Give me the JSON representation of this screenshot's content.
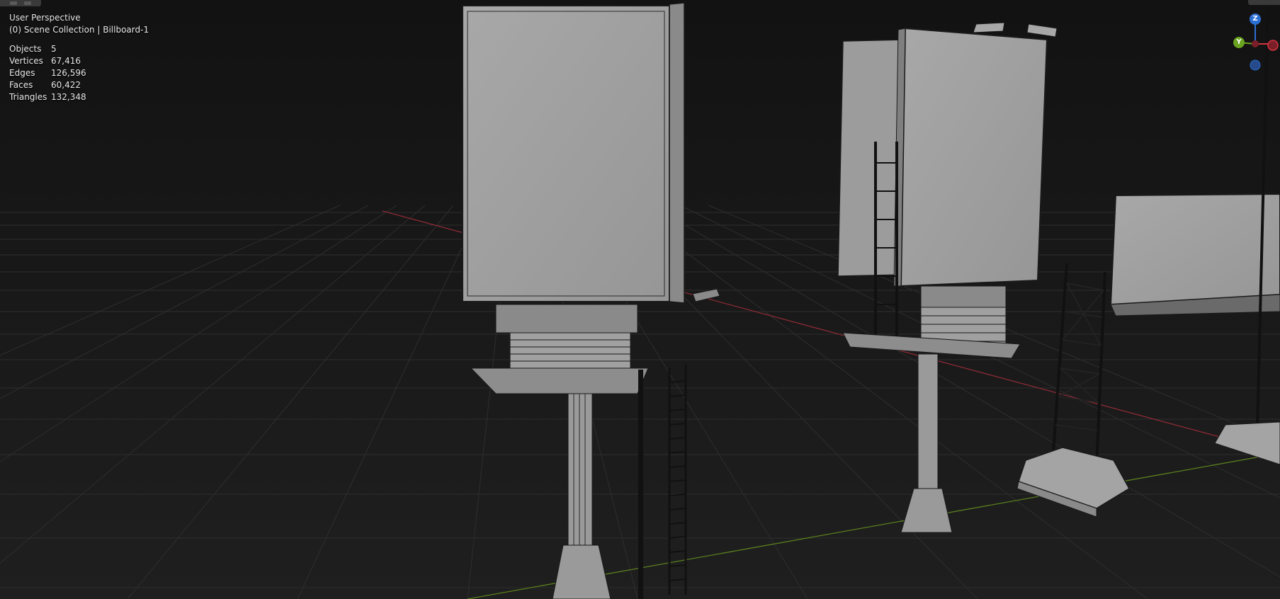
{
  "viewport": {
    "view_name": "User Perspective",
    "collection_line": "(0) Scene Collection | Billboard-1",
    "stats": [
      {
        "label": "Objects",
        "value": "5"
      },
      {
        "label": "Vertices",
        "value": "67,416"
      },
      {
        "label": "Edges",
        "value": "126,596"
      },
      {
        "label": "Faces",
        "value": "60,422"
      },
      {
        "label": "Triangles",
        "value": "132,348"
      }
    ]
  },
  "gizmo": {
    "z_label": "Z",
    "y_label": "Y",
    "colors": {
      "x": "#d0343f",
      "y": "#6aa420",
      "z": "#2c6fd3",
      "neg": "#264a8a"
    }
  },
  "colors": {
    "background": "#161616",
    "grid": "#2c2c2c",
    "x_axis_line": "#8c2a36",
    "y_axis_line": "#5b7f1e",
    "mesh_face": "#9a9a9a",
    "wire": "#1a1a1a"
  }
}
